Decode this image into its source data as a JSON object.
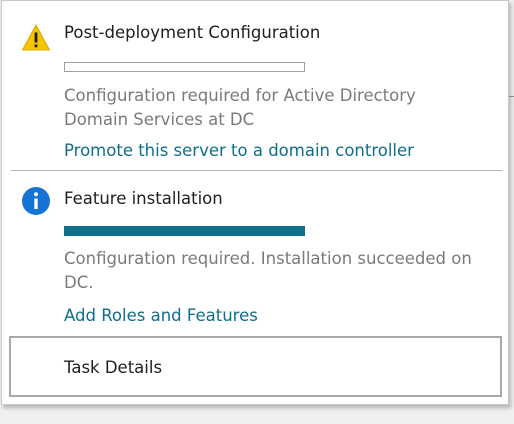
{
  "notifications": [
    {
      "icon": "warning-icon",
      "title": "Post-deployment Configuration",
      "progress": 0,
      "description": "Configuration required for Active Directory Domain Services at DC",
      "link": "Promote this server to a domain controller"
    },
    {
      "icon": "info-icon",
      "title": "Feature installation",
      "progress": 1,
      "description": "Configuration required. Installation succeeded on DC.",
      "link": "Add Roles and Features"
    }
  ],
  "task_details": {
    "label": "Task Details"
  },
  "colors": {
    "warning": "#f5c400",
    "info": "#1573d4",
    "progress": "#0e6e8c",
    "link": "#0e6e8c"
  }
}
